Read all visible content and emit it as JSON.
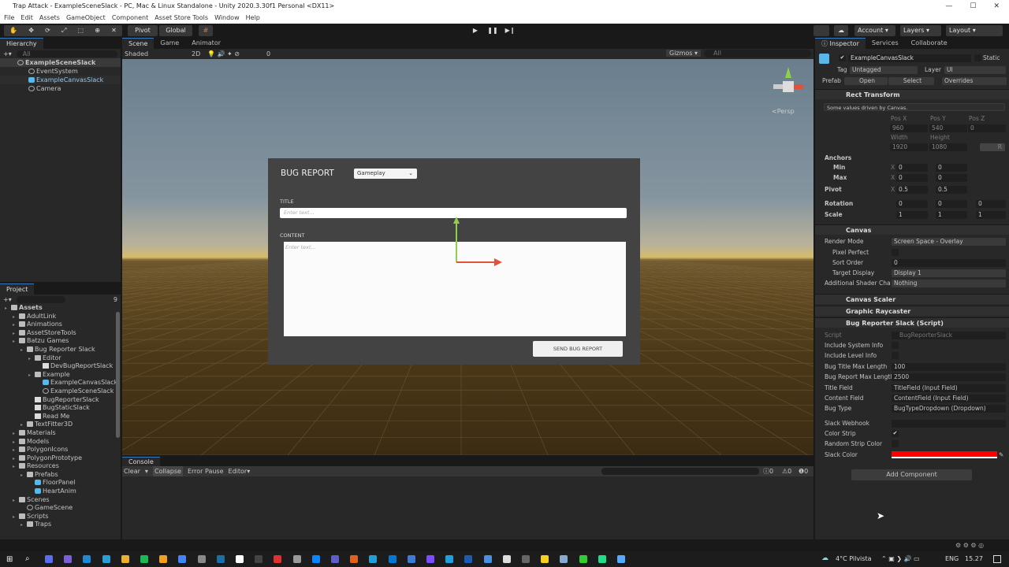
{
  "window": {
    "title": "Trap Attack - ExampleSceneSlack - PC, Mac & Linux Standalone - Unity 2020.3.30f1 Personal <DX11>",
    "controls": [
      "—",
      "☐",
      "✕"
    ]
  },
  "menu": [
    "File",
    "Edit",
    "Assets",
    "GameObject",
    "Component",
    "Asset Store Tools",
    "Window",
    "Help"
  ],
  "toolbar": {
    "tools": [
      "✋",
      "✥",
      "⟳",
      "⤢",
      "⬚",
      "⊕",
      "✕"
    ],
    "pivot": "Pivot",
    "global": "Global",
    "snap": "#",
    "play": "▶",
    "pause": "❚❚",
    "step": "▶❙",
    "account": "Account",
    "layers": "Layers",
    "layout": "Layout"
  },
  "hierarchy": {
    "tab": "Hierarchy",
    "search_placeholder": "All",
    "items": [
      {
        "label": "ExampleSceneSlack",
        "depth": 0,
        "icon": "unity-scene-icon"
      },
      {
        "label": "EventSystem",
        "depth": 1,
        "icon": "gameobject-icon"
      },
      {
        "label": "ExampleCanvasSlack",
        "depth": 1,
        "icon": "prefab-cube-icon"
      },
      {
        "label": "Camera",
        "depth": 1,
        "icon": "gameobject-icon"
      }
    ]
  },
  "project": {
    "tab": "Project",
    "hidden_count": "9",
    "items": [
      {
        "label": "Assets",
        "depth": 0,
        "icon": "folder"
      },
      {
        "label": "AdultLink",
        "depth": 1,
        "icon": "folder"
      },
      {
        "label": "Animations",
        "depth": 1,
        "icon": "folder"
      },
      {
        "label": "AssetStoreTools",
        "depth": 1,
        "icon": "folder"
      },
      {
        "label": "Batzu Games",
        "depth": 1,
        "icon": "folder"
      },
      {
        "label": "Bug Reporter Slack",
        "depth": 2,
        "icon": "folder"
      },
      {
        "label": "Editor",
        "depth": 3,
        "icon": "folder"
      },
      {
        "label": "DevBugReportSlack",
        "depth": 4,
        "icon": "script"
      },
      {
        "label": "Example",
        "depth": 3,
        "icon": "folder"
      },
      {
        "label": "ExampleCanvasSlack",
        "depth": 4,
        "icon": "cube"
      },
      {
        "label": "ExampleSceneSlack",
        "depth": 4,
        "icon": "scene"
      },
      {
        "label": "BugReporterSlack",
        "depth": 3,
        "icon": "script"
      },
      {
        "label": "BugStaticSlack",
        "depth": 3,
        "icon": "script"
      },
      {
        "label": "Read Me",
        "depth": 3,
        "icon": "script"
      },
      {
        "label": "TextFitter3D",
        "depth": 2,
        "icon": "folder"
      },
      {
        "label": "Materials",
        "depth": 1,
        "icon": "folder"
      },
      {
        "label": "Models",
        "depth": 1,
        "icon": "folder"
      },
      {
        "label": "PolygonIcons",
        "depth": 1,
        "icon": "folder"
      },
      {
        "label": "PolygonPrototype",
        "depth": 1,
        "icon": "folder"
      },
      {
        "label": "Resources",
        "depth": 1,
        "icon": "folder"
      },
      {
        "label": "Prefabs",
        "depth": 2,
        "icon": "folder"
      },
      {
        "label": "FloorPanel",
        "depth": 3,
        "icon": "cube"
      },
      {
        "label": "HeartAnim",
        "depth": 3,
        "icon": "cube"
      },
      {
        "label": "Scenes",
        "depth": 1,
        "icon": "folder"
      },
      {
        "label": "GameScene",
        "depth": 2,
        "icon": "scene"
      },
      {
        "label": "Scripts",
        "depth": 1,
        "icon": "folder"
      },
      {
        "label": "Traps",
        "depth": 2,
        "icon": "folder"
      }
    ]
  },
  "scene": {
    "tabs": [
      "Scene",
      "Game",
      "Animator"
    ],
    "shading": "Shaded",
    "mode2d": "2D",
    "hidden": "0",
    "gizmos": "Gizmos",
    "search_placeholder": "All",
    "persp": "<Persp"
  },
  "bug_report": {
    "title": "BUG REPORT",
    "type": "Gameplay",
    "title_label": "TITLE",
    "title_placeholder": "Enter text...",
    "content_label": "CONTENT",
    "content_placeholder": "Enter text...",
    "send": "SEND BUG REPORT"
  },
  "console": {
    "tab": "Console",
    "clear": "Clear",
    "collapse": "Collapse",
    "error_pause": "Error Pause",
    "editor": "Editor",
    "logs": "0",
    "warnings": "0",
    "errors": "0"
  },
  "inspector": {
    "tabs": [
      "Inspector",
      "Services",
      "Collaborate"
    ],
    "name": "ExampleCanvasSlack",
    "static": "Static",
    "tag_label": "Tag",
    "tag": "Untagged",
    "layer_label": "Layer",
    "layer": "UI",
    "prefab_label": "Prefab",
    "open": "Open",
    "select": "Select",
    "overrides": "Overrides",
    "rect": {
      "title": "Rect Transform",
      "note": "Some values driven by Canvas.",
      "posx_l": "Pos X",
      "posy_l": "Pos Y",
      "posz_l": "Pos Z",
      "posx": "960",
      "posy": "540",
      "posz": "0",
      "w_l": "Width",
      "h_l": "Height",
      "w": "1920",
      "h": "1080",
      "r": "R",
      "anchors": "Anchors",
      "min": "Min",
      "max": "Max",
      "pivot": "Pivot",
      "rotation": "Rotation",
      "scale": "Scale",
      "minx": "0",
      "miny": "0",
      "maxx": "0",
      "maxy": "0",
      "pivx": "0.5",
      "pivy": "0.5",
      "rotx": "0",
      "roty": "0",
      "rotz": "0",
      "scx": "1",
      "scy": "1",
      "scz": "1"
    },
    "canvas": {
      "title": "Canvas",
      "render_mode_l": "Render Mode",
      "render_mode": "Screen Space - Overlay",
      "pixel_perfect": "Pixel Perfect",
      "sort_order_l": "Sort Order",
      "sort_order": "0",
      "target_display_l": "Target Display",
      "target_display": "Display 1",
      "shader_l": "Additional Shader Cha",
      "shader": "Nothing"
    },
    "canvas_scaler": "Canvas Scaler",
    "graphic_raycaster": "Graphic Raycaster",
    "script": {
      "title": "Bug Reporter Slack (Script)",
      "script_l": "Script",
      "script": "BugReporterSlack",
      "sys_info": "Include System Info",
      "level_info": "Include Level Info",
      "title_max_l": "Bug Title Max Length",
      "title_max": "100",
      "report_max_l": "Bug Report Max Lengtl",
      "report_max": "2500",
      "title_field_l": "Title Field",
      "title_field": "TitleField (Input Field)",
      "content_field_l": "Content Field",
      "content_field": "ContentField (Input Field)",
      "bug_type_l": "Bug Type",
      "bug_type": "BugTypeDropdown (Dropdown)",
      "webhook_l": "Slack Webhook",
      "webhook": "",
      "color_strip": "Color Strip",
      "color_strip_on": true,
      "random_strip": "Random Strip Color",
      "slack_color_l": "Slack Color",
      "slack_color": "#ff0000"
    },
    "add_component": "Add Component"
  },
  "taskbar": {
    "weather": "4°C Pilvista",
    "lang": "ENG",
    "time": "15.27"
  }
}
